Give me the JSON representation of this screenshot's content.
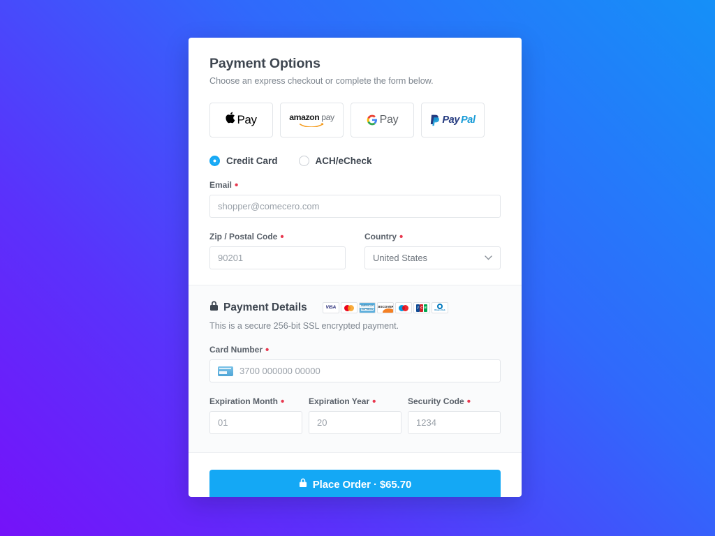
{
  "header": {
    "title": "Payment Options",
    "subtitle": "Choose an express checkout or complete the form below."
  },
  "express_checkout": {
    "buttons": [
      {
        "name": "apple-pay",
        "glyph": "",
        "label": "Pay"
      },
      {
        "name": "amazon-pay",
        "label_bold": "amazon",
        "label_light": "pay"
      },
      {
        "name": "google-pay",
        "letter": "G",
        "label": "Pay"
      },
      {
        "name": "paypal",
        "label_dark": "Pay",
        "label_light": "Pal"
      }
    ]
  },
  "payment_method": {
    "selected": "Credit Card",
    "options": [
      {
        "label": "Credit Card",
        "checked": true
      },
      {
        "label": "ACH/eCheck",
        "checked": false
      }
    ]
  },
  "billing": {
    "email": {
      "label": "Email",
      "required_mark": "•",
      "placeholder": "shopper@comecero.com",
      "value": ""
    },
    "zip": {
      "label": "Zip / Postal Code",
      "required_mark": "•",
      "placeholder": "90201",
      "value": ""
    },
    "country": {
      "label": "Country",
      "required_mark": "•",
      "value": "United States",
      "chevron": "⌄"
    }
  },
  "payment_details": {
    "lock_icon": "🔒",
    "title": "Payment Details",
    "subtitle": "This is a secure 256-bit SSL encrypted payment.",
    "accepted_cards": [
      {
        "name": "visa",
        "text": "VISA"
      },
      {
        "name": "mastercard",
        "text": ""
      },
      {
        "name": "american-express",
        "line1": "AMERICAN",
        "line2": "EXPRESS"
      },
      {
        "name": "discover",
        "text": "DISCOVER"
      },
      {
        "name": "maestro",
        "text": ""
      },
      {
        "name": "jcb",
        "text": "JCB"
      },
      {
        "name": "diners-club",
        "text": "Diners Club"
      }
    ],
    "card_number": {
      "label": "Card Number",
      "required_mark": "•",
      "placeholder": "3700 000000 00000",
      "value": ""
    },
    "expiration_month": {
      "label": "Expiration Month",
      "required_mark": "•",
      "placeholder": "01",
      "value": ""
    },
    "expiration_year": {
      "label": "Expiration Year",
      "required_mark": "•",
      "placeholder": "20",
      "value": ""
    },
    "security_code": {
      "label": "Security Code",
      "required_mark": "•",
      "placeholder": "1234",
      "value": ""
    }
  },
  "footer": {
    "place_order": {
      "lock_icon": "🔒",
      "label": "Place Order · $65.70",
      "amount": "$65.70"
    }
  },
  "colors": {
    "accent": "#14a8f5",
    "required": "#e8384f",
    "text_dark": "#3e4650",
    "text_muted": "#7d858e",
    "bg_gradient_start": "#7512f9",
    "bg_gradient_end": "#1590f8"
  }
}
